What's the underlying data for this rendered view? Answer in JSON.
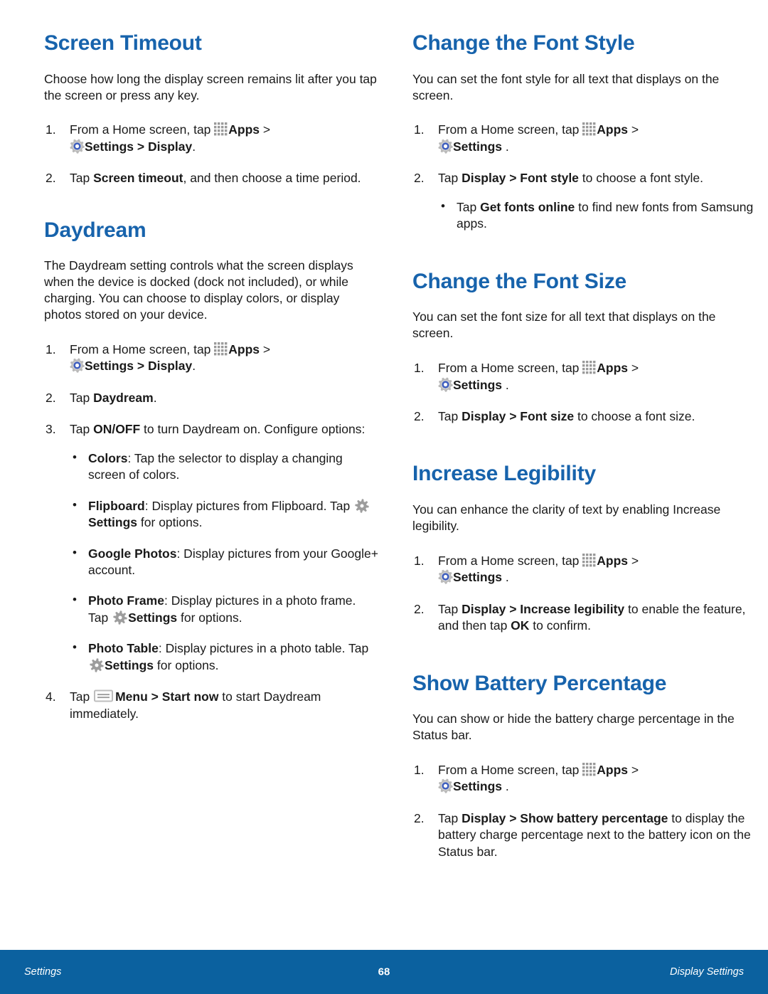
{
  "icons": {
    "apps": "apps-grid-icon",
    "settings": "settings-gear-icon",
    "gear": "gear-icon",
    "menu": "menu-icon"
  },
  "colors": {
    "heading": "#1763ac",
    "footer_bg": "#0b619f",
    "body_text": "#1a1a1a",
    "icon_gray": "#8c8c8c",
    "gear_blue": "#3f5fbf"
  },
  "left_column": {
    "sections": [
      {
        "title": "Screen Timeout",
        "intro": "Choose how long the display screen remains lit after you tap the screen or press any key.",
        "steps": [
          {
            "num": "1.",
            "parts": [
              {
                "t": "text",
                "v": "From a Home screen, tap "
              },
              {
                "t": "icon",
                "v": "apps"
              },
              {
                "t": "bold",
                "v": "Apps"
              },
              {
                "t": "text",
                "v": "  > "
              },
              {
                "t": "break"
              },
              {
                "t": "icon",
                "v": "settings"
              },
              {
                "t": "bold",
                "v": "Settings"
              },
              {
                "t": "bold",
                "v": "  > Display"
              },
              {
                "t": "text",
                "v": "."
              }
            ]
          },
          {
            "num": "2.",
            "parts": [
              {
                "t": "text",
                "v": "Tap "
              },
              {
                "t": "bold",
                "v": "Screen timeout"
              },
              {
                "t": "text",
                "v": ", and then choose a time period."
              }
            ]
          }
        ]
      },
      {
        "title": "Daydream",
        "intro": "The Daydream setting controls what the screen displays when the device is docked (dock not included), or while charging. You can choose to display colors, or display photos stored on your device.",
        "steps": [
          {
            "num": "1.",
            "parts": [
              {
                "t": "text",
                "v": "From a Home screen, tap "
              },
              {
                "t": "icon",
                "v": "apps"
              },
              {
                "t": "bold",
                "v": "Apps"
              },
              {
                "t": "text",
                "v": "  > "
              },
              {
                "t": "break"
              },
              {
                "t": "icon",
                "v": "settings"
              },
              {
                "t": "bold",
                "v": "Settings"
              },
              {
                "t": "bold",
                "v": "  > Display"
              },
              {
                "t": "text",
                "v": "."
              }
            ]
          },
          {
            "num": "2.",
            "parts": [
              {
                "t": "text",
                "v": "Tap "
              },
              {
                "t": "bold",
                "v": "Daydream"
              },
              {
                "t": "text",
                "v": "."
              }
            ]
          },
          {
            "num": "3.",
            "parts": [
              {
                "t": "text",
                "v": "Tap "
              },
              {
                "t": "bold",
                "v": "ON/OFF"
              },
              {
                "t": "text",
                "v": " to turn Daydream on. Configure options:"
              }
            ],
            "bullets": [
              [
                {
                  "t": "bold",
                  "v": "Colors"
                },
                {
                  "t": "text",
                  "v": ": Tap the selector to display a changing screen of colors."
                }
              ],
              [
                {
                  "t": "bold",
                  "v": "Flipboard"
                },
                {
                  "t": "text",
                  "v": ": Display pictures from Flipboard. Tap "
                },
                {
                  "t": "icon",
                  "v": "gear"
                },
                {
                  "t": "bold",
                  "v": "Settings"
                },
                {
                  "t": "text",
                  "v": " for options."
                }
              ],
              [
                {
                  "t": "bold",
                  "v": "Google Photos"
                },
                {
                  "t": "text",
                  "v": ": Display pictures from your Google+ account."
                }
              ],
              [
                {
                  "t": "bold",
                  "v": "Photo Frame"
                },
                {
                  "t": "text",
                  "v": ": Display pictures in a photo frame. Tap "
                },
                {
                  "t": "icon",
                  "v": "gear"
                },
                {
                  "t": "bold",
                  "v": "Settings"
                },
                {
                  "t": "text",
                  "v": "  for options."
                }
              ],
              [
                {
                  "t": "bold",
                  "v": "Photo Table"
                },
                {
                  "t": "text",
                  "v": ": Display pictures in a photo table. Tap "
                },
                {
                  "t": "icon",
                  "v": "gear"
                },
                {
                  "t": "bold",
                  "v": "Settings"
                },
                {
                  "t": "text",
                  "v": " for options."
                }
              ]
            ]
          },
          {
            "num": "4.",
            "parts": [
              {
                "t": "text",
                "v": "Tap "
              },
              {
                "t": "icon",
                "v": "menu"
              },
              {
                "t": "bold",
                "v": "Menu > Start now"
              },
              {
                "t": "text",
                "v": " to start Daydream immediately."
              }
            ]
          }
        ]
      }
    ]
  },
  "right_column": {
    "sections": [
      {
        "title": "Change the Font Style",
        "intro": "You can set the font style for all text that displays on the screen.",
        "steps": [
          {
            "num": "1.",
            "parts": [
              {
                "t": "text",
                "v": "From a Home screen, tap "
              },
              {
                "t": "icon",
                "v": "apps"
              },
              {
                "t": "bold",
                "v": "Apps"
              },
              {
                "t": "text",
                "v": " > "
              },
              {
                "t": "break"
              },
              {
                "t": "icon",
                "v": "settings"
              },
              {
                "t": "bold",
                "v": "Settings"
              },
              {
                "t": "text",
                "v": " ."
              }
            ]
          },
          {
            "num": "2.",
            "parts": [
              {
                "t": "text",
                "v": "Tap "
              },
              {
                "t": "bold",
                "v": "Display > Font style"
              },
              {
                "t": "text",
                "v": " to choose a font style."
              }
            ],
            "bullets": [
              [
                {
                  "t": "text",
                  "v": "Tap "
                },
                {
                  "t": "bold",
                  "v": "Get fonts online"
                },
                {
                  "t": "text",
                  "v": " to find new fonts from Samsung apps."
                }
              ]
            ]
          }
        ]
      },
      {
        "title": "Change the Font Size",
        "intro": "You can set the font size for all text that displays on the screen.",
        "steps": [
          {
            "num": "1.",
            "parts": [
              {
                "t": "text",
                "v": "From a Home screen, tap "
              },
              {
                "t": "icon",
                "v": "apps"
              },
              {
                "t": "bold",
                "v": "Apps"
              },
              {
                "t": "text",
                "v": " > "
              },
              {
                "t": "break"
              },
              {
                "t": "icon",
                "v": "settings"
              },
              {
                "t": "bold",
                "v": "Settings"
              },
              {
                "t": "text",
                "v": " ."
              }
            ]
          },
          {
            "num": "2.",
            "parts": [
              {
                "t": "text",
                "v": "Tap "
              },
              {
                "t": "bold",
                "v": "Display > Font size"
              },
              {
                "t": "text",
                "v": " to choose a font size."
              }
            ]
          }
        ]
      },
      {
        "title": "Increase Legibility",
        "intro": "You can enhance the clarity of text by enabling Increase legibility.",
        "steps": [
          {
            "num": "1.",
            "parts": [
              {
                "t": "text",
                "v": "From a Home screen, tap "
              },
              {
                "t": "icon",
                "v": "apps"
              },
              {
                "t": "bold",
                "v": "Apps"
              },
              {
                "t": "text",
                "v": " > "
              },
              {
                "t": "break"
              },
              {
                "t": "icon",
                "v": "settings"
              },
              {
                "t": "bold",
                "v": "Settings"
              },
              {
                "t": "text",
                "v": " ."
              }
            ]
          },
          {
            "num": "2.",
            "parts": [
              {
                "t": "text",
                "v": "Tap "
              },
              {
                "t": "bold",
                "v": "Display > Increase legibility"
              },
              {
                "t": "text",
                "v": " to enable the feature, and then tap "
              },
              {
                "t": "bold",
                "v": "OK"
              },
              {
                "t": "text",
                "v": " to confirm."
              }
            ]
          }
        ]
      },
      {
        "title": "Show Battery Percentage",
        "intro": "You can show or hide the battery charge percentage in the Status bar.",
        "steps": [
          {
            "num": "1.",
            "parts": [
              {
                "t": "text",
                "v": "From a Home screen, tap "
              },
              {
                "t": "icon",
                "v": "apps"
              },
              {
                "t": "bold",
                "v": "Apps"
              },
              {
                "t": "text",
                "v": " > "
              },
              {
                "t": "break"
              },
              {
                "t": "icon",
                "v": "settings"
              },
              {
                "t": "bold",
                "v": "Settings"
              },
              {
                "t": "text",
                "v": " ."
              }
            ]
          },
          {
            "num": "2.",
            "parts": [
              {
                "t": "text",
                "v": "Tap "
              },
              {
                "t": "bold",
                "v": "Display > Show battery percentage"
              },
              {
                "t": "text",
                "v": " to display the battery charge percentage next to the battery icon on the Status bar."
              }
            ]
          }
        ]
      }
    ]
  },
  "footer": {
    "left": "Settings",
    "page_number": "68",
    "right": "Display Settings"
  }
}
